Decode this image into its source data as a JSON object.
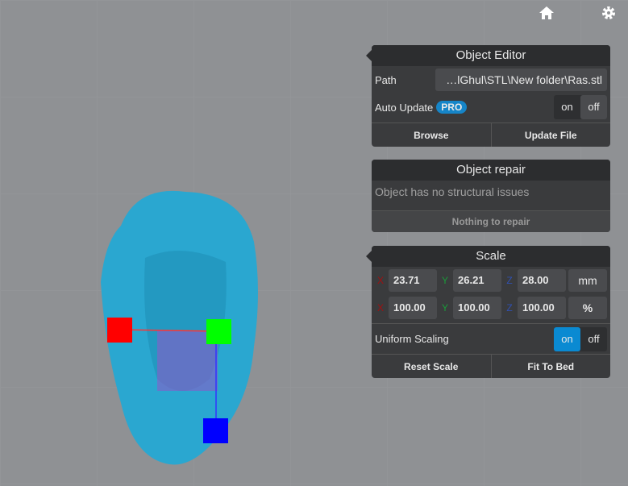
{
  "toolbar": {
    "home_icon": "home-icon",
    "settings_icon": "gear-icon"
  },
  "object_editor": {
    "title": "Object Editor",
    "path_label": "Path",
    "path_value": "…lGhul\\STL\\New folder\\Ras.stl",
    "auto_update_label": "Auto Update",
    "pro_badge": "PRO",
    "toggle_on": "on",
    "toggle_off": "off",
    "auto_update_state": "off",
    "browse": "Browse",
    "update_file": "Update File"
  },
  "object_repair": {
    "title": "Object repair",
    "status": "Object has no structural issues",
    "button": "Nothing to repair"
  },
  "scale": {
    "title": "Scale",
    "x_label": "X",
    "y_label": "Y",
    "z_label": "Z",
    "size": {
      "x": "23.71",
      "y": "26.21",
      "z": "28.00",
      "unit": "mm"
    },
    "percent": {
      "x": "100.00",
      "y": "100.00",
      "z": "100.00",
      "unit": "%"
    },
    "uniform_label": "Uniform Scaling",
    "toggle_on": "on",
    "toggle_off": "off",
    "uniform_state": "on",
    "reset": "Reset Scale",
    "fit": "Fit To Bed"
  },
  "colors": {
    "accent": "#0a8ad2",
    "model": "#2aa7d0",
    "axis_x": "#ff0000",
    "axis_y": "#00ff00",
    "axis_z": "#0000ff"
  }
}
